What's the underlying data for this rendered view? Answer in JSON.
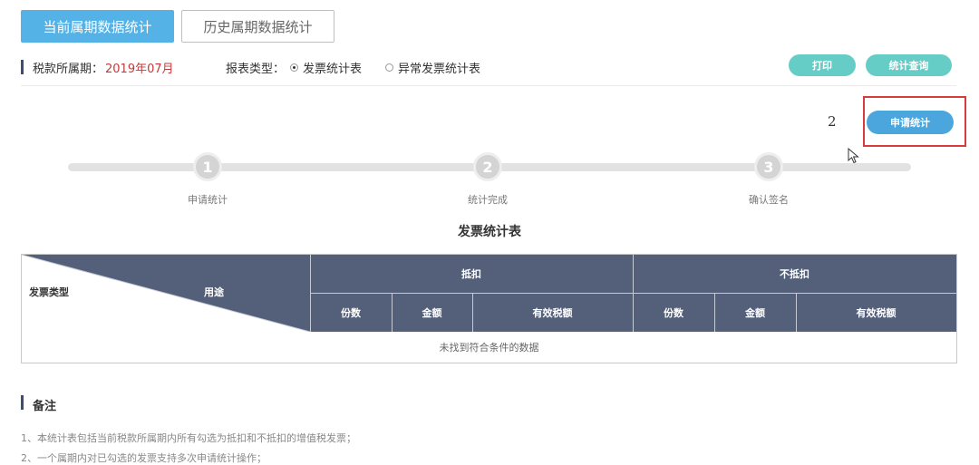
{
  "tabs": {
    "current": "当前属期数据统计",
    "history": "历史属期数据统计"
  },
  "filter": {
    "period_label": "税款所属期：",
    "period_value": "2019年07月",
    "report_type_label": "报表类型：",
    "option_invoice": "发票统计表",
    "option_abnormal": "异常发票统计表",
    "selected": "发票统计表"
  },
  "actions": {
    "print": "打印",
    "query": "统计查询",
    "apply": "申请统计"
  },
  "annotation": "2",
  "steps": [
    {
      "number": "1",
      "label": "申请统计"
    },
    {
      "number": "2",
      "label": "统计完成"
    },
    {
      "number": "3",
      "label": "确认签名"
    }
  ],
  "table": {
    "title": "发票统计表",
    "corner_left": "发票类型",
    "corner_right": "用途",
    "group_deduct": "抵扣",
    "group_nondeduct": "不抵扣",
    "sub_count": "份数",
    "sub_amount": "金额",
    "sub_tax": "有效税额",
    "empty_text": "未找到符合条件的数据"
  },
  "notes": {
    "title": "备注",
    "items": [
      "1、本统计表包括当前税款所属期内所有勾选为抵扣和不抵扣的增值税发票；",
      "2、一个属期内对已勾选的发票支持多次申请统计操作；"
    ]
  },
  "colors": {
    "accent": "#55b2e6",
    "header": "#54607a",
    "teal": "#66cdc6",
    "period": "#c43a3a",
    "highlight": "#d93b3b"
  }
}
